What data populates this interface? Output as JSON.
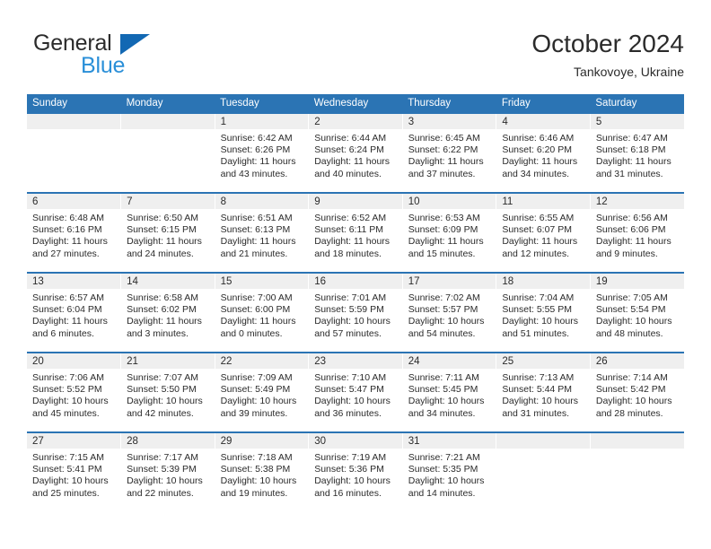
{
  "brand": {
    "name_top": "General",
    "name_bottom": "Blue",
    "triangle_icon": "blue-triangle-icon",
    "color_top": "#2b2b2b",
    "color_bottom": "#2a8fd8",
    "triangle_color": "#1268b3"
  },
  "header": {
    "title": "October 2024",
    "subtitle": "Tankovoye, Ukraine"
  },
  "theme": {
    "header_bg": "#2b74b4",
    "header_text": "#ffffff",
    "daynum_band_bg": "#efefef",
    "cell_bg": "#ffffff",
    "text": "#2b2b2b"
  },
  "weekday_headers": [
    "Sunday",
    "Monday",
    "Tuesday",
    "Wednesday",
    "Thursday",
    "Friday",
    "Saturday"
  ],
  "labels": {
    "sunrise_prefix": "Sunrise: ",
    "sunset_prefix": "Sunset: ",
    "daylight_prefix": "Daylight: "
  },
  "weeks": [
    [
      {
        "day": "",
        "sunrise": "",
        "sunset": "",
        "daylight": "",
        "empty": true
      },
      {
        "day": "",
        "sunrise": "",
        "sunset": "",
        "daylight": "",
        "empty": true
      },
      {
        "day": "1",
        "sunrise": "Sunrise: 6:42 AM",
        "sunset": "Sunset: 6:26 PM",
        "daylight": "Daylight: 11 hours and 43 minutes."
      },
      {
        "day": "2",
        "sunrise": "Sunrise: 6:44 AM",
        "sunset": "Sunset: 6:24 PM",
        "daylight": "Daylight: 11 hours and 40 minutes."
      },
      {
        "day": "3",
        "sunrise": "Sunrise: 6:45 AM",
        "sunset": "Sunset: 6:22 PM",
        "daylight": "Daylight: 11 hours and 37 minutes."
      },
      {
        "day": "4",
        "sunrise": "Sunrise: 6:46 AM",
        "sunset": "Sunset: 6:20 PM",
        "daylight": "Daylight: 11 hours and 34 minutes."
      },
      {
        "day": "5",
        "sunrise": "Sunrise: 6:47 AM",
        "sunset": "Sunset: 6:18 PM",
        "daylight": "Daylight: 11 hours and 31 minutes."
      }
    ],
    [
      {
        "day": "6",
        "sunrise": "Sunrise: 6:48 AM",
        "sunset": "Sunset: 6:16 PM",
        "daylight": "Daylight: 11 hours and 27 minutes."
      },
      {
        "day": "7",
        "sunrise": "Sunrise: 6:50 AM",
        "sunset": "Sunset: 6:15 PM",
        "daylight": "Daylight: 11 hours and 24 minutes."
      },
      {
        "day": "8",
        "sunrise": "Sunrise: 6:51 AM",
        "sunset": "Sunset: 6:13 PM",
        "daylight": "Daylight: 11 hours and 21 minutes."
      },
      {
        "day": "9",
        "sunrise": "Sunrise: 6:52 AM",
        "sunset": "Sunset: 6:11 PM",
        "daylight": "Daylight: 11 hours and 18 minutes."
      },
      {
        "day": "10",
        "sunrise": "Sunrise: 6:53 AM",
        "sunset": "Sunset: 6:09 PM",
        "daylight": "Daylight: 11 hours and 15 minutes."
      },
      {
        "day": "11",
        "sunrise": "Sunrise: 6:55 AM",
        "sunset": "Sunset: 6:07 PM",
        "daylight": "Daylight: 11 hours and 12 minutes."
      },
      {
        "day": "12",
        "sunrise": "Sunrise: 6:56 AM",
        "sunset": "Sunset: 6:06 PM",
        "daylight": "Daylight: 11 hours and 9 minutes."
      }
    ],
    [
      {
        "day": "13",
        "sunrise": "Sunrise: 6:57 AM",
        "sunset": "Sunset: 6:04 PM",
        "daylight": "Daylight: 11 hours and 6 minutes."
      },
      {
        "day": "14",
        "sunrise": "Sunrise: 6:58 AM",
        "sunset": "Sunset: 6:02 PM",
        "daylight": "Daylight: 11 hours and 3 minutes."
      },
      {
        "day": "15",
        "sunrise": "Sunrise: 7:00 AM",
        "sunset": "Sunset: 6:00 PM",
        "daylight": "Daylight: 11 hours and 0 minutes."
      },
      {
        "day": "16",
        "sunrise": "Sunrise: 7:01 AM",
        "sunset": "Sunset: 5:59 PM",
        "daylight": "Daylight: 10 hours and 57 minutes."
      },
      {
        "day": "17",
        "sunrise": "Sunrise: 7:02 AM",
        "sunset": "Sunset: 5:57 PM",
        "daylight": "Daylight: 10 hours and 54 minutes."
      },
      {
        "day": "18",
        "sunrise": "Sunrise: 7:04 AM",
        "sunset": "Sunset: 5:55 PM",
        "daylight": "Daylight: 10 hours and 51 minutes."
      },
      {
        "day": "19",
        "sunrise": "Sunrise: 7:05 AM",
        "sunset": "Sunset: 5:54 PM",
        "daylight": "Daylight: 10 hours and 48 minutes."
      }
    ],
    [
      {
        "day": "20",
        "sunrise": "Sunrise: 7:06 AM",
        "sunset": "Sunset: 5:52 PM",
        "daylight": "Daylight: 10 hours and 45 minutes."
      },
      {
        "day": "21",
        "sunrise": "Sunrise: 7:07 AM",
        "sunset": "Sunset: 5:50 PM",
        "daylight": "Daylight: 10 hours and 42 minutes."
      },
      {
        "day": "22",
        "sunrise": "Sunrise: 7:09 AM",
        "sunset": "Sunset: 5:49 PM",
        "daylight": "Daylight: 10 hours and 39 minutes."
      },
      {
        "day": "23",
        "sunrise": "Sunrise: 7:10 AM",
        "sunset": "Sunset: 5:47 PM",
        "daylight": "Daylight: 10 hours and 36 minutes."
      },
      {
        "day": "24",
        "sunrise": "Sunrise: 7:11 AM",
        "sunset": "Sunset: 5:45 PM",
        "daylight": "Daylight: 10 hours and 34 minutes."
      },
      {
        "day": "25",
        "sunrise": "Sunrise: 7:13 AM",
        "sunset": "Sunset: 5:44 PM",
        "daylight": "Daylight: 10 hours and 31 minutes."
      },
      {
        "day": "26",
        "sunrise": "Sunrise: 7:14 AM",
        "sunset": "Sunset: 5:42 PM",
        "daylight": "Daylight: 10 hours and 28 minutes."
      }
    ],
    [
      {
        "day": "27",
        "sunrise": "Sunrise: 7:15 AM",
        "sunset": "Sunset: 5:41 PM",
        "daylight": "Daylight: 10 hours and 25 minutes."
      },
      {
        "day": "28",
        "sunrise": "Sunrise: 7:17 AM",
        "sunset": "Sunset: 5:39 PM",
        "daylight": "Daylight: 10 hours and 22 minutes."
      },
      {
        "day": "29",
        "sunrise": "Sunrise: 7:18 AM",
        "sunset": "Sunset: 5:38 PM",
        "daylight": "Daylight: 10 hours and 19 minutes."
      },
      {
        "day": "30",
        "sunrise": "Sunrise: 7:19 AM",
        "sunset": "Sunset: 5:36 PM",
        "daylight": "Daylight: 10 hours and 16 minutes."
      },
      {
        "day": "31",
        "sunrise": "Sunrise: 7:21 AM",
        "sunset": "Sunset: 5:35 PM",
        "daylight": "Daylight: 10 hours and 14 minutes."
      },
      {
        "day": "",
        "sunrise": "",
        "sunset": "",
        "daylight": "",
        "empty": true
      },
      {
        "day": "",
        "sunrise": "",
        "sunset": "",
        "daylight": "",
        "empty": true
      }
    ]
  ]
}
